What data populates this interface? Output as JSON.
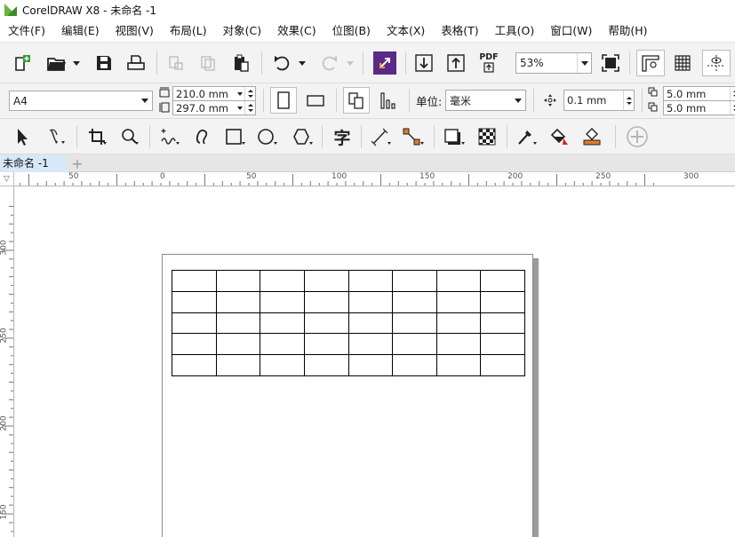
{
  "window": {
    "title": "CorelDRAW X8 - 未命名 -1"
  },
  "menu": [
    "文件(F)",
    "编辑(E)",
    "视图(V)",
    "布局(L)",
    "对象(C)",
    "效果(C)",
    "位图(B)",
    "文本(X)",
    "表格(T)",
    "工具(O)",
    "窗口(W)",
    "帮助(H)"
  ],
  "standard_toolbar": {
    "zoom_level": "53%",
    "pdf_label": "PDF"
  },
  "property_bar": {
    "page_size": "A4",
    "width": "210.0 mm",
    "height": "297.0 mm",
    "units_label": "单位:",
    "units_value": "毫米",
    "nudge": "0.1 mm",
    "dup_x": "5.0 mm",
    "dup_y": "5.0 mm"
  },
  "toolbox": {
    "text_tool_glyph": "字"
  },
  "document_tabs": {
    "active": "未命名 -1",
    "add": "+"
  },
  "rulers": {
    "corner": "▽",
    "horizontal_ticks": [
      "50",
      "0",
      "50",
      "100",
      "150",
      "200",
      "250",
      "300"
    ],
    "vertical_ticks": [
      "300",
      "250",
      "200",
      "150"
    ]
  },
  "table": {
    "rows": 5,
    "cols": 8
  },
  "colors": {
    "logo_green": "#6cb33e",
    "accent_purple": "#5b2a86",
    "tab_active": "#d7e8f8"
  }
}
